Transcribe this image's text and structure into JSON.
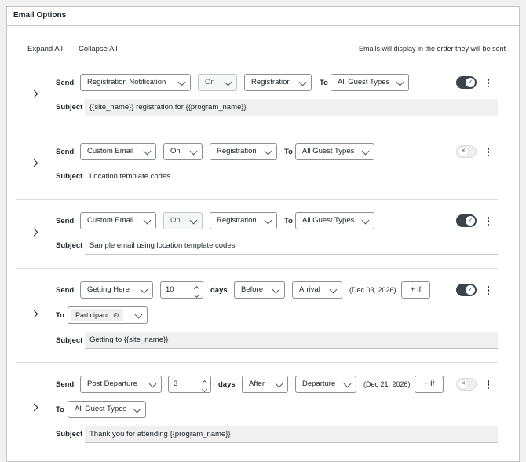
{
  "panel": {
    "title": "Email Options"
  },
  "toolbar": {
    "expand_all": "Expand All",
    "collapse_all": "Collapse All",
    "order_note": "Emails will display in the order they will be sent"
  },
  "labels": {
    "send": "Send",
    "to": "To",
    "subject": "Subject",
    "days": "days",
    "if": "+ If",
    "toggle_check": "✓",
    "toggle_x": "✕"
  },
  "emails": [
    {
      "template": "Registration Notification",
      "state": "On",
      "trigger": "Registration",
      "to": "All Guest Types",
      "subject": "{{site_name}} registration for {{program_name}}",
      "enabled": true
    },
    {
      "template": "Custom Email",
      "state": "On",
      "trigger": "Registration",
      "to": "All Guest Types",
      "subject": "Location template codes",
      "enabled": false
    },
    {
      "template": "Custom Email",
      "state": "On",
      "trigger": "Registration",
      "to": "All Guest Types",
      "subject": "Sample email using location template codes",
      "enabled": true
    },
    {
      "template": "Getting Here",
      "days": "10",
      "when": "Before",
      "event": "Arrival",
      "date": "(Dec 03, 2026)",
      "to": "Participant",
      "to_icon": "⊙",
      "subject": "Getting to {{site_name}}",
      "enabled": true
    },
    {
      "template": "Post Departure",
      "days": "3",
      "when": "After",
      "event": "Departure",
      "date": "(Dec 21, 2026)",
      "to": "All Guest Types",
      "subject": "Thank you for attending {{program_name}}",
      "enabled": false
    }
  ]
}
